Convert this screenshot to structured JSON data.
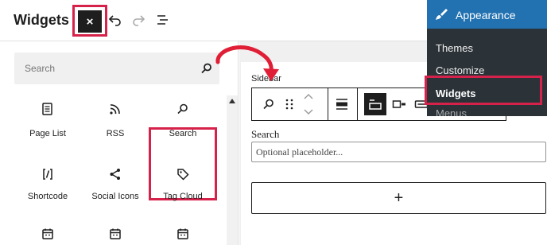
{
  "topbar": {
    "title": "Widgets",
    "close_label": "×",
    "icons": [
      "close-icon",
      "undo-icon",
      "redo-icon",
      "list-view-icon"
    ]
  },
  "inserter": {
    "search_placeholder": "Search",
    "blocks": [
      {
        "label": "Page List",
        "icon": "page-list-icon"
      },
      {
        "label": "RSS",
        "icon": "rss-icon"
      },
      {
        "label": "Search",
        "icon": "search-icon"
      },
      {
        "label": "Shortcode",
        "icon": "shortcode-icon"
      },
      {
        "label": "Social Icons",
        "icon": "share-icon"
      },
      {
        "label": "Tag Cloud",
        "icon": "tag-icon"
      },
      {
        "label": "",
        "icon": "calendar-icon"
      },
      {
        "label": "",
        "icon": "calendar-icon"
      },
      {
        "label": "",
        "icon": "calendar-icon"
      }
    ]
  },
  "editor": {
    "area_label": "Sidebar",
    "search_block": {
      "label": "Search",
      "placeholder": "Optional placeholder..."
    },
    "appender_label": "+"
  },
  "admin_menu": {
    "header": "Appearance",
    "items": [
      {
        "label": "Themes",
        "current": false
      },
      {
        "label": "Customize",
        "current": false
      },
      {
        "label": "Widgets",
        "current": true
      },
      {
        "label": "Menus",
        "current": false
      }
    ]
  },
  "colors": {
    "highlight": "#d6224a",
    "admin_bg": "#2c3338",
    "admin_accent": "#2271b1",
    "dark": "#1e1e1e"
  }
}
